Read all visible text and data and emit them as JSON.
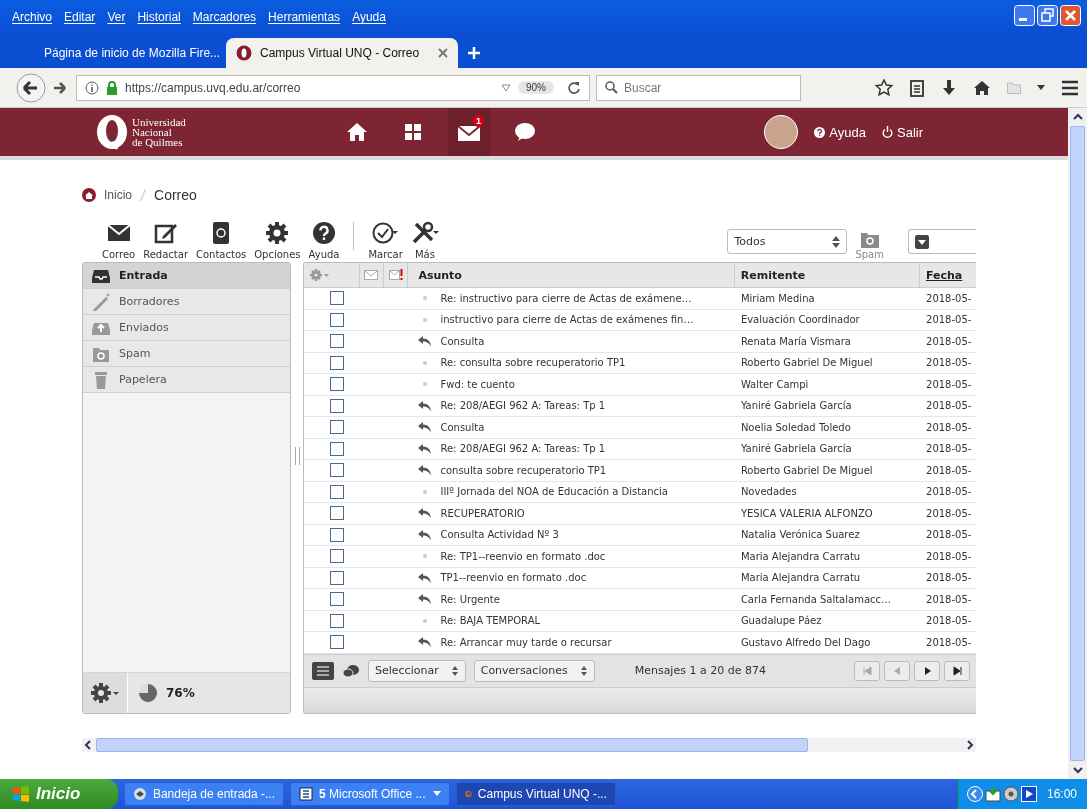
{
  "menu_bar": [
    "Archivo",
    "Editar",
    "Ver",
    "Historial",
    "Marcadores",
    "Herramientas",
    "Ayuda"
  ],
  "tabs": [
    {
      "kind": "firefox",
      "label": "Página de inicio de Mozilla Fire...",
      "selected": false
    },
    {
      "kind": "unq",
      "label": "Campus Virtual UNQ - Correo",
      "selected": true
    }
  ],
  "address_bar": {
    "url": "https://campus.uvq.edu.ar/correo",
    "zoom": "90%"
  },
  "search": {
    "placeholder": "Buscar"
  },
  "site_header": {
    "logo_lines": [
      "Universidad",
      "Nacional",
      "de Quilmes"
    ],
    "nav": [
      {
        "kind": "home",
        "selected": false
      },
      {
        "kind": "apps",
        "selected": false
      },
      {
        "kind": "mail",
        "selected": true,
        "badge": "1"
      },
      {
        "kind": "chat",
        "selected": false
      }
    ],
    "help": "Ayuda",
    "logout": "Salir"
  },
  "breadcrumb": [
    "Inicio",
    "Correo"
  ],
  "toolbar": [
    {
      "kind": "mail",
      "label": "Correo",
      "menu": false
    },
    {
      "kind": "compose",
      "label": "Redactar",
      "menu": false
    },
    {
      "kind": "contacts",
      "label": "Contactos",
      "menu": false
    },
    {
      "kind": "gear",
      "label": "Opciones",
      "menu": false
    },
    {
      "kind": "help",
      "label": "Ayuda",
      "menu": false
    },
    {
      "kind": "mark",
      "label": "Marcar",
      "menu": true
    },
    {
      "kind": "tools",
      "label": "Más",
      "menu": true
    }
  ],
  "filter": {
    "value": "Todos"
  },
  "spam_button": {
    "label": "Spam",
    "disabled": true
  },
  "folders": [
    {
      "kind": "inbox",
      "label": "Entrada",
      "selected": true
    },
    {
      "kind": "drafts",
      "label": "Borradores",
      "selected": false
    },
    {
      "kind": "sent",
      "label": "Enviados",
      "selected": false
    },
    {
      "kind": "spam",
      "label": "Spam",
      "selected": false
    },
    {
      "kind": "trash",
      "label": "Papelera",
      "selected": false
    }
  ],
  "quota": {
    "reading": "76%"
  },
  "messages": {
    "columns": [
      {
        "label": "Asunto",
        "sorted": false
      },
      {
        "label": "Remitente",
        "sorted": false
      },
      {
        "label": "Fecha",
        "sorted": true
      }
    ],
    "rows": [
      {
        "checked": false,
        "kind": "dot",
        "subject": "Re: instructivo para cierre de Actas de exámene…",
        "sender": "Miriam Medina",
        "date": "2018-05-"
      },
      {
        "checked": false,
        "kind": "dot",
        "subject": "instructivo para cierre de Actas de exámenes fin…",
        "sender": "Evaluación Coordinador",
        "date": "2018-05-"
      },
      {
        "checked": false,
        "kind": "replied",
        "subject": "Consulta",
        "sender": "Renata María Vismara",
        "date": "2018-05-"
      },
      {
        "checked": false,
        "kind": "dot",
        "subject": "Re: consulta sobre recuperatorio TP1",
        "sender": "Roberto Gabriel De Miguel",
        "date": "2018-05-"
      },
      {
        "checked": false,
        "kind": "dot",
        "subject": "Fwd: te cuento",
        "sender": "Walter Campi",
        "date": "2018-05-"
      },
      {
        "checked": false,
        "kind": "replied",
        "subject": "Re: 208/AEGI 962 A: Tareas: Tp 1",
        "sender": "Yaniré Gabriela García",
        "date": "2018-05-"
      },
      {
        "checked": false,
        "kind": "replied",
        "subject": "Consulta",
        "sender": "Noelia Soledad Toledo",
        "date": "2018-05-"
      },
      {
        "checked": false,
        "kind": "replied",
        "subject": "Re: 208/AEGI 962 A: Tareas: Tp 1",
        "sender": "Yaniré Gabriela García",
        "date": "2018-05-"
      },
      {
        "checked": false,
        "kind": "replied",
        "subject": "consulta sobre recuperatorio TP1",
        "sender": "Roberto Gabriel De Miguel",
        "date": "2018-05-"
      },
      {
        "checked": false,
        "kind": "dot",
        "subject": "IIIº Jornada del NOA de Educación a Distancia",
        "sender": "Novedades",
        "date": "2018-05-"
      },
      {
        "checked": false,
        "kind": "replied",
        "subject": "RECUPERATORIO",
        "sender": "YESICA VALERIA ALFONZO",
        "date": "2018-05-"
      },
      {
        "checked": false,
        "kind": "replied",
        "subject": "Consulta Actividad Nº 3",
        "sender": "Natalia Verónica Suarez",
        "date": "2018-05-"
      },
      {
        "checked": false,
        "kind": "dot",
        "subject": "Re: TP1--reenvio en formato .doc",
        "sender": "Maria Alejandra Carratu",
        "date": "2018-05-"
      },
      {
        "checked": false,
        "kind": "replied",
        "subject": "TP1--reenvio en formato .doc",
        "sender": "Maria Alejandra Carratu",
        "date": "2018-05-"
      },
      {
        "checked": false,
        "kind": "replied",
        "subject": "Re: Urgente",
        "sender": "Carla Fernanda Saltalamacc…",
        "date": "2018-05-"
      },
      {
        "checked": false,
        "kind": "dot",
        "subject": "Re: BAJA TEMPORAL",
        "sender": "Guadalupe Páez",
        "date": "2018-05-"
      },
      {
        "checked": false,
        "kind": "replied",
        "subject": "Re: Arrancar muy tarde o recursar",
        "sender": "Gustavo Alfredo Del Dago",
        "date": "2018-05-"
      }
    ]
  },
  "list_footer": {
    "select": "Seleccionar",
    "threads": "Conversaciones",
    "count": "Mensajes 1 a 20 de 874"
  },
  "taskbar": {
    "start": "Inicio",
    "items": [
      {
        "kind": "mail",
        "label": "Bandeja de entrada -...",
        "selected": false
      },
      {
        "kind": "word",
        "label": "**5** Microsoft Office ...",
        "selected": false
      },
      {
        "kind": "firefox",
        "label": "Campus Virtual UNQ -...",
        "selected": true
      }
    ],
    "clock": "16:00"
  }
}
